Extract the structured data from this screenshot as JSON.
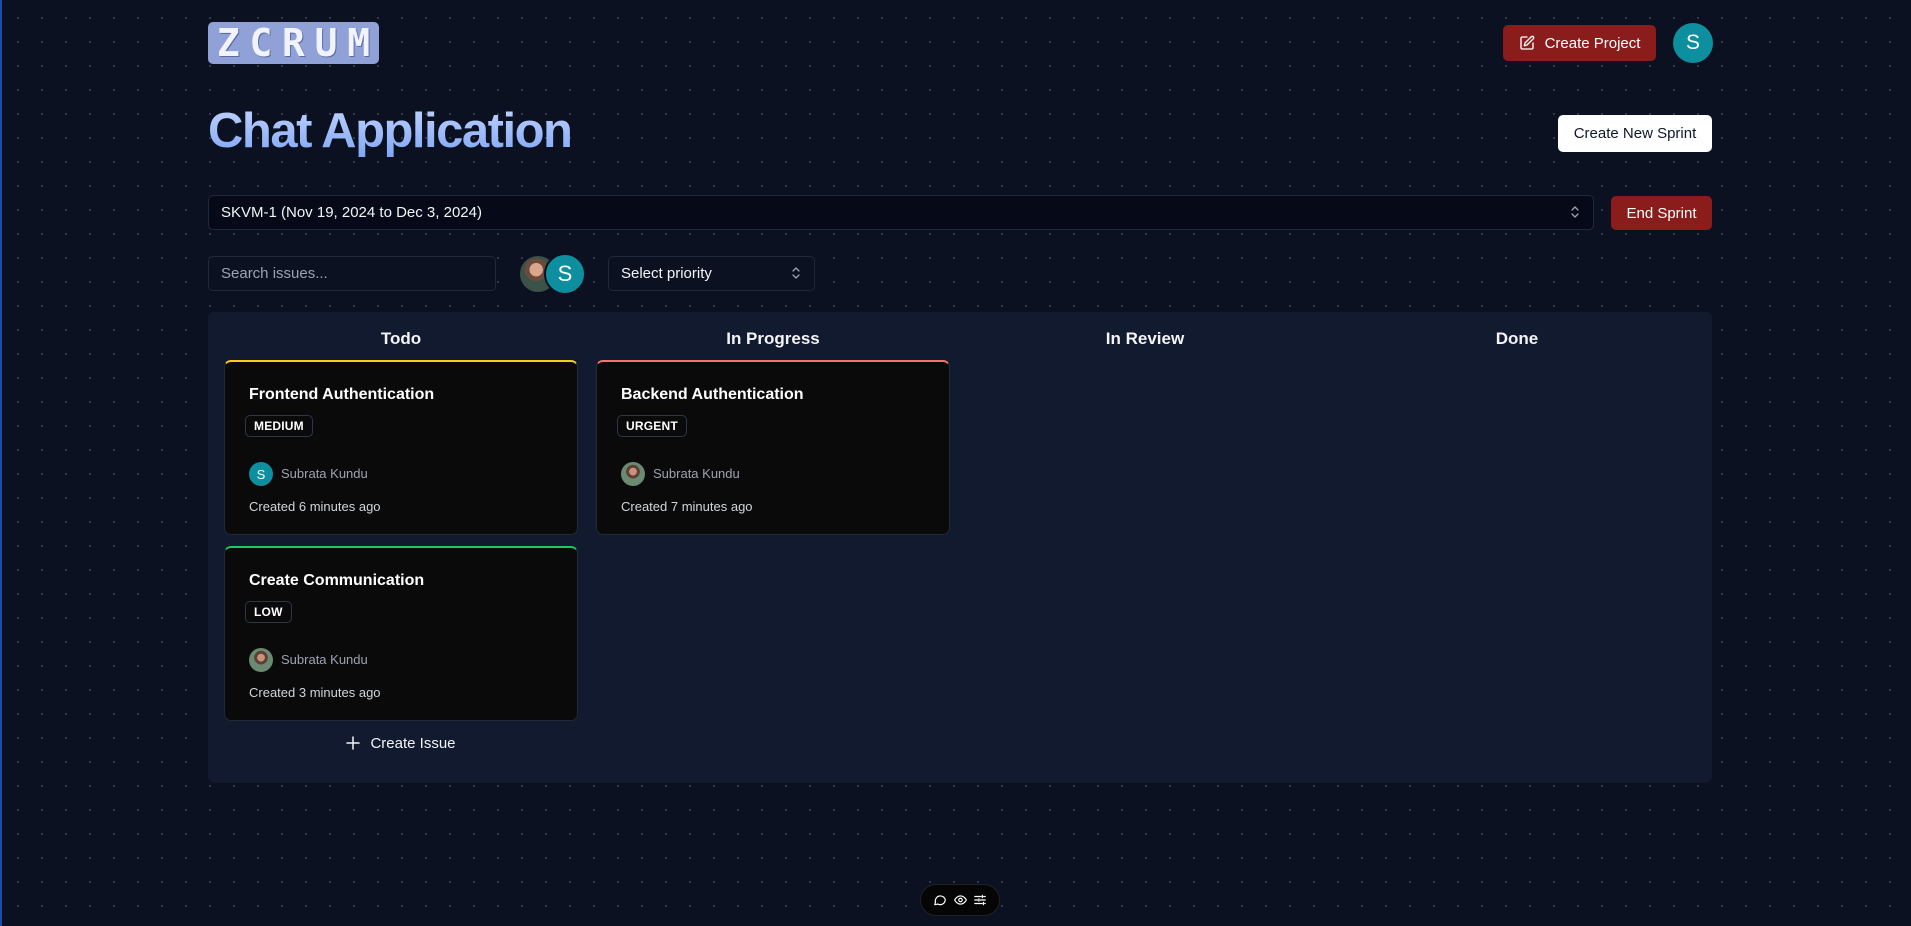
{
  "app": {
    "logo_letters": [
      "Z",
      "C",
      "R",
      "U",
      "M"
    ]
  },
  "header": {
    "create_project_label": "Create Project",
    "user_avatar_letter": "S"
  },
  "project": {
    "title": "Chat Application",
    "create_sprint_label": "Create New Sprint"
  },
  "sprint": {
    "selected": "SKVM-1 (Nov 19, 2024 to Dec 3, 2024)",
    "end_label": "End Sprint"
  },
  "filters": {
    "search_placeholder": "Search issues...",
    "assignee_letter": "S",
    "priority_placeholder": "Select priority"
  },
  "board": {
    "columns": [
      {
        "title": "Todo"
      },
      {
        "title": "In Progress"
      },
      {
        "title": "In Review"
      },
      {
        "title": "Done"
      }
    ],
    "issues": [
      {
        "title": "Frontend Authentication",
        "priority": "MEDIUM",
        "priority_color": "#facc15",
        "assignee": "Subrata Kundu",
        "avatar_letter": "S",
        "created": "Created 6 minutes ago"
      },
      {
        "title": "Create Communication",
        "priority": "LOW",
        "priority_color": "#22c55e",
        "assignee": "Subrata Kundu",
        "created": "Created 3 minutes ago"
      },
      {
        "title": "Backend Authentication",
        "priority": "URGENT",
        "priority_color": "#f87171",
        "assignee": "Subrata Kundu",
        "created": "Created 7 minutes ago"
      }
    ],
    "create_issue_label": "Create Issue"
  },
  "toolbar_icons": [
    "comment-icon",
    "eye-icon",
    "settings-sliders-icon"
  ]
}
